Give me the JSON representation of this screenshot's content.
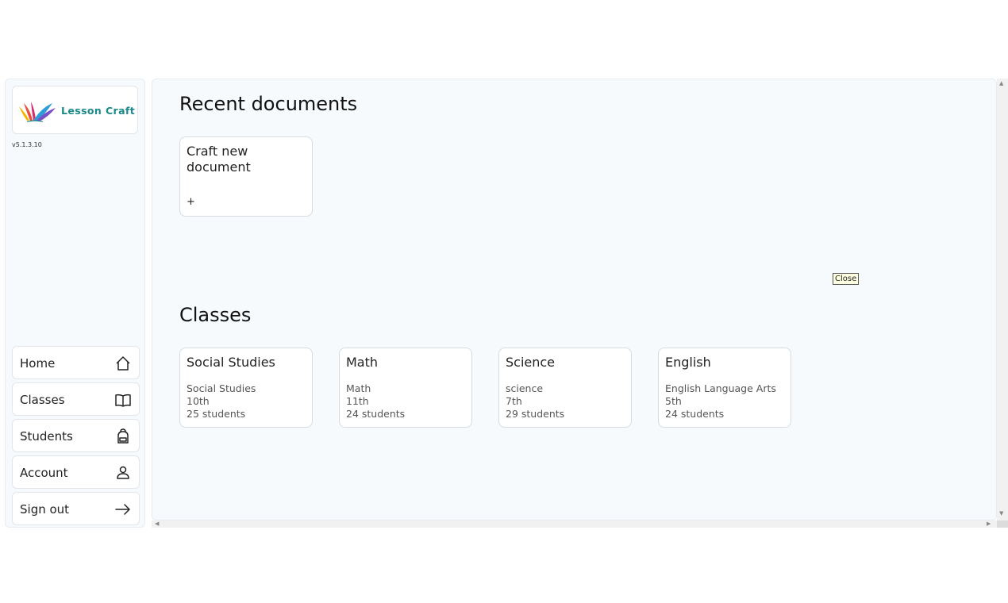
{
  "logo": {
    "text": "Lesson Craft"
  },
  "version": "v5.1.3.10",
  "nav": {
    "home": "Home",
    "classes": "Classes",
    "students": "Students",
    "account": "Account",
    "sign_out": "Sign out"
  },
  "recent": {
    "title": "Recent documents",
    "new_doc_label": "Craft new document",
    "plus": "+"
  },
  "tooltip": "Close",
  "classes": {
    "title": "Classes",
    "items": [
      {
        "name": "Social Studies",
        "subject": "Social Studies",
        "grade": "10th",
        "students": "25 students"
      },
      {
        "name": "Math",
        "subject": "Math",
        "grade": "11th",
        "students": "24 students"
      },
      {
        "name": "Science",
        "subject": "science",
        "grade": "7th",
        "students": "29 students"
      },
      {
        "name": "English",
        "subject": "English Language Arts",
        "grade": "5th",
        "students": "24 students"
      }
    ]
  }
}
